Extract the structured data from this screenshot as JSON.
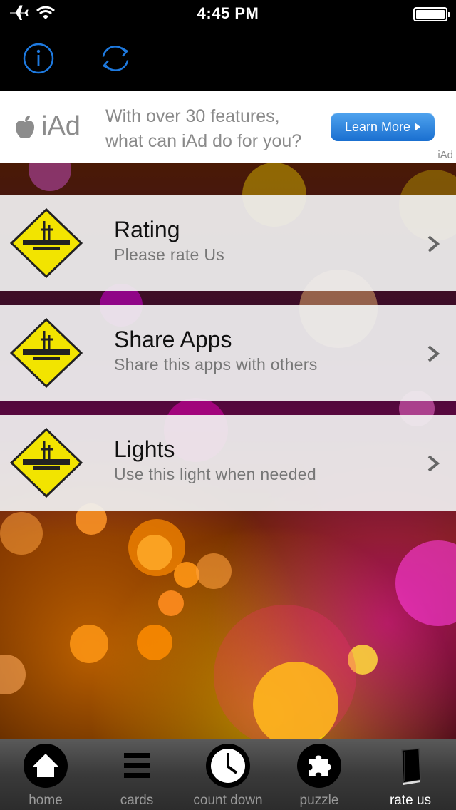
{
  "status_bar": {
    "time": "4:45 PM"
  },
  "ad": {
    "logo_text": "iAd",
    "line1": "With over 30 features,",
    "line2": "what can iAd do for you?",
    "button_label": "Learn More",
    "mark": "iAd"
  },
  "menu": [
    {
      "title": "Rating",
      "subtitle": "Please rate Us"
    },
    {
      "title": "Share Apps",
      "subtitle": "Share this apps with others"
    },
    {
      "title": "Lights",
      "subtitle": "Use this light when needed"
    }
  ],
  "tabs": [
    {
      "label": "home",
      "icon": "home-icon"
    },
    {
      "label": "cards",
      "icon": "cards-icon"
    },
    {
      "label": "count down",
      "icon": "clock-icon"
    },
    {
      "label": "puzzle",
      "icon": "puzzle-icon"
    },
    {
      "label": "rate us",
      "icon": "book-icon",
      "active": true
    }
  ],
  "colors": {
    "accent": "#1e7ae0",
    "ad_button": "#2b84e0"
  }
}
